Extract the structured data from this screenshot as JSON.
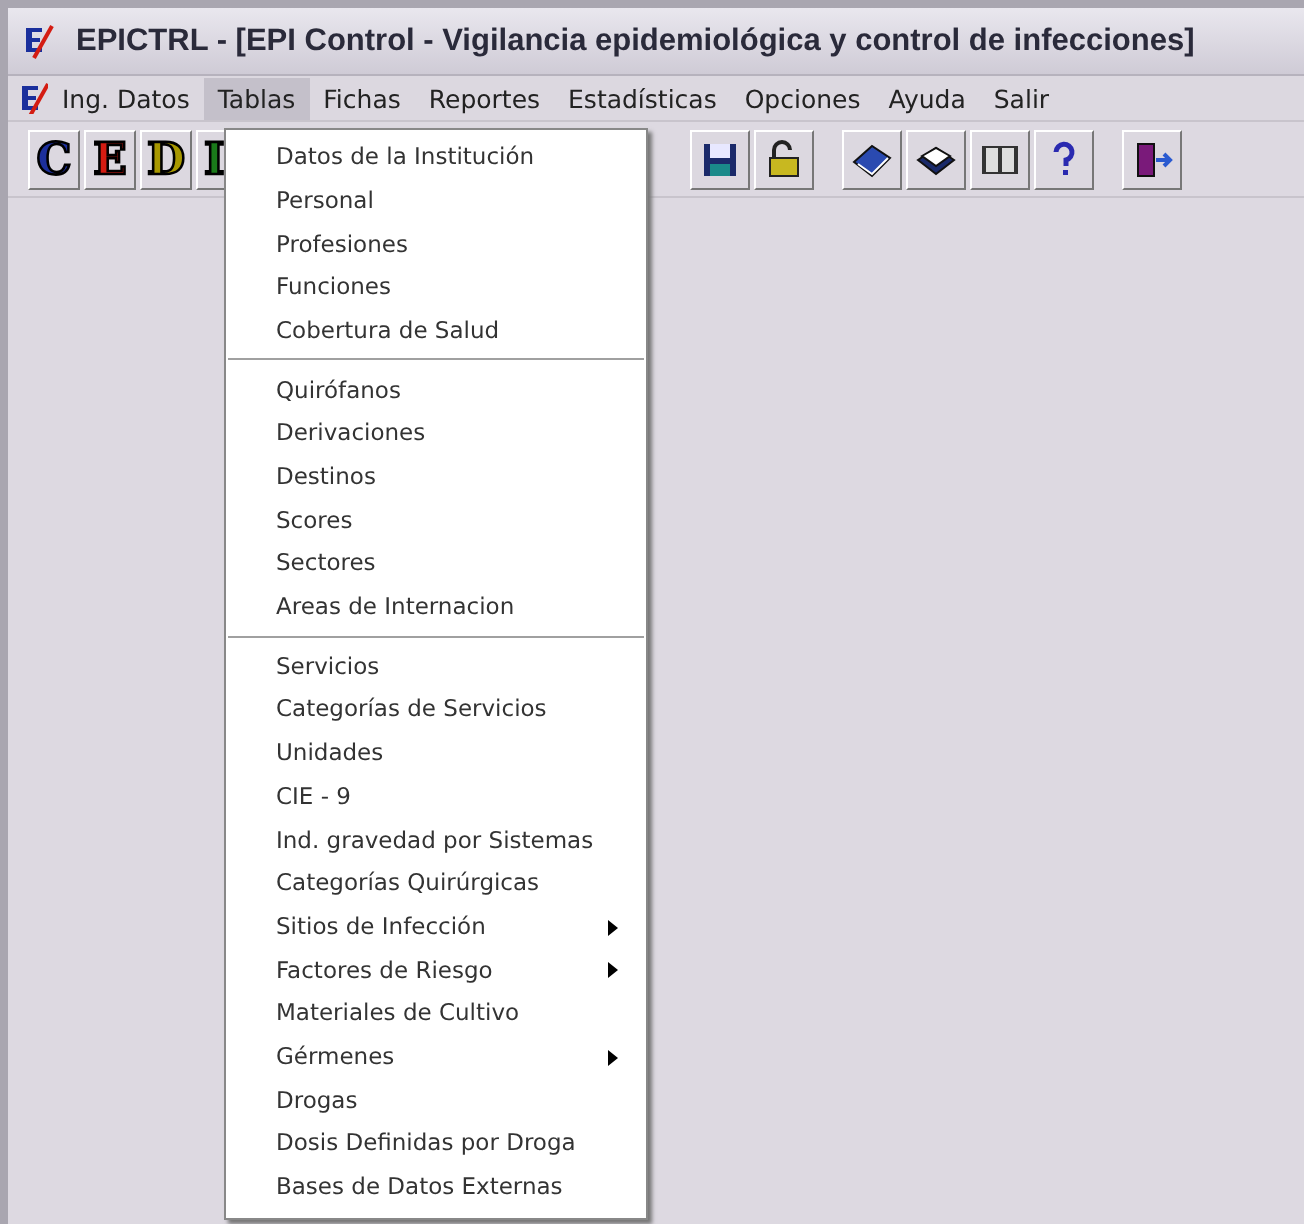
{
  "window": {
    "title": "EPICTRL - [EPI Control - Vigilancia epidemiológica y control de infecciones]"
  },
  "menu_bar": [
    {
      "label": "Ing. Datos",
      "selected": false
    },
    {
      "label": "Tablas",
      "selected": true
    },
    {
      "label": "Fichas",
      "selected": false
    },
    {
      "label": "Reportes",
      "selected": false
    },
    {
      "label": "Estadísticas",
      "selected": false
    },
    {
      "label": "Opciones",
      "selected": false
    },
    {
      "label": "Ayuda",
      "selected": false
    },
    {
      "label": "Salir",
      "selected": false
    }
  ],
  "toolbar": [
    {
      "kind": "letter",
      "text": "C",
      "color": "#1c2f9c"
    },
    {
      "kind": "letter",
      "text": "E",
      "color": "#d41c12"
    },
    {
      "kind": "letter",
      "text": "D",
      "color": "#a89800"
    },
    {
      "kind": "letter",
      "text": "I",
      "color": "#1a7a1a"
    },
    {
      "kind": "floppy"
    },
    {
      "kind": "lock"
    },
    {
      "kind": "gap"
    },
    {
      "kind": "book"
    },
    {
      "kind": "openbook"
    },
    {
      "kind": "pages"
    },
    {
      "kind": "help"
    },
    {
      "kind": "gap"
    },
    {
      "kind": "exit"
    }
  ],
  "dropdown": {
    "groups": [
      [
        {
          "label": "Datos de la Institución",
          "submenu": false
        },
        {
          "label": "Personal",
          "submenu": false
        },
        {
          "label": "Profesiones",
          "submenu": false
        },
        {
          "label": "Funciones",
          "submenu": false
        },
        {
          "label": "Cobertura de Salud",
          "submenu": false
        }
      ],
      [
        {
          "label": "Quirófanos",
          "submenu": false
        },
        {
          "label": "Derivaciones",
          "submenu": false
        },
        {
          "label": "Destinos",
          "submenu": false
        },
        {
          "label": "Scores",
          "submenu": false
        },
        {
          "label": "Sectores",
          "submenu": false
        },
        {
          "label": "Areas de Internacion",
          "submenu": false
        }
      ],
      [
        {
          "label": "Servicios",
          "submenu": false
        },
        {
          "label": "Categorías de Servicios",
          "submenu": false
        },
        {
          "label": "Unidades",
          "submenu": false
        },
        {
          "label": "CIE - 9",
          "submenu": false
        },
        {
          "label": "Ind. gravedad por Sistemas",
          "submenu": false
        },
        {
          "label": "Categorías Quirúrgicas",
          "submenu": false
        },
        {
          "label": "Sitios de Infección",
          "submenu": true
        },
        {
          "label": "Factores de Riesgo",
          "submenu": true
        },
        {
          "label": "Materiales de Cultivo",
          "submenu": false
        },
        {
          "label": "Gérmenes",
          "submenu": true
        },
        {
          "label": "Drogas",
          "submenu": false
        },
        {
          "label": "Dosis Definidas por Droga",
          "submenu": false
        },
        {
          "label": "Bases de Datos Externas",
          "submenu": false
        }
      ]
    ]
  }
}
